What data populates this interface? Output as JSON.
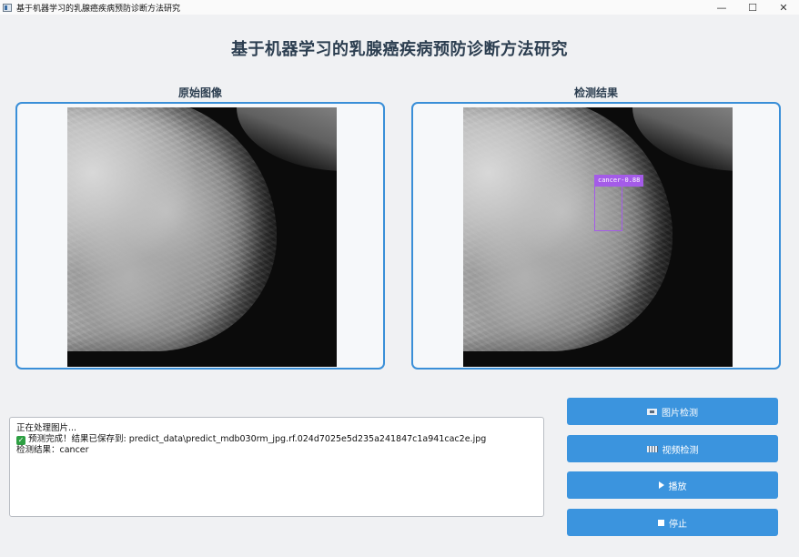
{
  "window": {
    "title": "基于机器学习的乳腺癌疾病预防诊断方法研究",
    "minimize": "—",
    "maximize": "☐",
    "close": "✕"
  },
  "header": {
    "title": "基于机器学习的乳腺癌疾病预防诊断方法研究"
  },
  "panels": {
    "original_label": "原始图像",
    "result_label": "检测结果"
  },
  "detection": {
    "label": "cancer-0.88",
    "box_color": "#a45be8"
  },
  "log": {
    "line1": "正在处理图片...",
    "line2": "预测完成！结果已保存到: predict_data\\predict_mdb030rm_jpg.rf.024d7025e5d235a241847c1a941cac2e.jpg",
    "line3": "检测结果：cancer"
  },
  "buttons": {
    "image_detect": "图片检测",
    "video_detect": "视频检测",
    "play": "播放",
    "stop": "停止"
  },
  "colors": {
    "accent": "#3b94de",
    "panel_border": "#3a8fd8",
    "title": "#2c3e50"
  }
}
